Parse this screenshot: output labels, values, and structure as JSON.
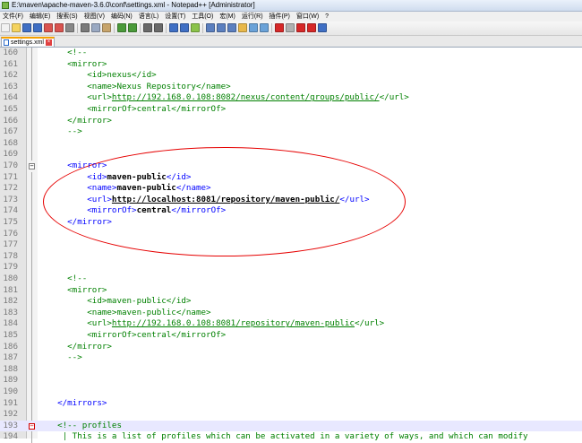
{
  "window": {
    "title": "E:\\maven\\apache-maven-3.6.0\\conf\\settings.xml - Notepad++ [Administrator]"
  },
  "menu": [
    "文件(F)",
    "编辑(E)",
    "搜索(S)",
    "视图(V)",
    "编码(N)",
    "语言(L)",
    "设置(T)",
    "工具(O)",
    "宏(M)",
    "运行(R)",
    "插件(P)",
    "窗口(W)",
    "?"
  ],
  "toolbar": {
    "icons": [
      "new-file-icon",
      "open-icon",
      "save-icon",
      "save-all-icon",
      "close-icon",
      "close-all-icon",
      "print-icon",
      "cut-icon",
      "copy-icon",
      "paste-icon",
      "undo-icon",
      "redo-icon",
      "find-icon",
      "replace-icon",
      "zoom-in-icon",
      "zoom-out-icon",
      "sync-icon",
      "wrap-icon",
      "indent-guide-icon",
      "all-chars-icon",
      "folder-icon",
      "doc-map-icon",
      "function-list-icon",
      "record-macro-icon",
      "stop-macro-icon",
      "play-macro-icon",
      "run-macro-icon",
      "save-macro-icon"
    ]
  },
  "tab": {
    "label": "settings.xml"
  },
  "lines": [
    {
      "n": "160",
      "fold": "",
      "parts": [
        {
          "c": "cm",
          "t": "    <!--"
        }
      ]
    },
    {
      "n": "161",
      "fold": "",
      "parts": [
        {
          "c": "cm",
          "t": "    <mirror>"
        }
      ]
    },
    {
      "n": "162",
      "fold": "",
      "parts": [
        {
          "c": "cm",
          "t": "        <id>nexus</id>"
        }
      ]
    },
    {
      "n": "163",
      "fold": "",
      "parts": [
        {
          "c": "cm",
          "t": "        <name>Nexus Repository</name>"
        }
      ]
    },
    {
      "n": "164",
      "fold": "",
      "parts": [
        {
          "c": "cm",
          "t": "        <url>"
        },
        {
          "c": "cm ul",
          "t": "http://192.168.0.108:8082/nexus/content/groups/public/"
        },
        {
          "c": "cm",
          "t": "</url>"
        }
      ]
    },
    {
      "n": "165",
      "fold": "",
      "parts": [
        {
          "c": "cm",
          "t": "        <mirrorOf>central</mirrorOf>"
        }
      ]
    },
    {
      "n": "166",
      "fold": "",
      "parts": [
        {
          "c": "cm",
          "t": "    </mirror>"
        }
      ]
    },
    {
      "n": "167",
      "fold": "",
      "parts": [
        {
          "c": "cm",
          "t": "    -->"
        }
      ]
    },
    {
      "n": "168",
      "fold": "",
      "parts": []
    },
    {
      "n": "169",
      "fold": "",
      "parts": []
    },
    {
      "n": "170",
      "fold": "box",
      "parts": [
        {
          "c": "tg",
          "t": "    <mirror>"
        }
      ]
    },
    {
      "n": "171",
      "fold": "",
      "parts": [
        {
          "c": "tg",
          "t": "        <id>"
        },
        {
          "c": "bd",
          "t": "maven-public"
        },
        {
          "c": "tg",
          "t": "</id>"
        }
      ]
    },
    {
      "n": "172",
      "fold": "",
      "parts": [
        {
          "c": "tg",
          "t": "        <name>"
        },
        {
          "c": "bd",
          "t": "maven-public"
        },
        {
          "c": "tg",
          "t": "</name>"
        }
      ]
    },
    {
      "n": "173",
      "fold": "",
      "parts": [
        {
          "c": "tg",
          "t": "        <url>"
        },
        {
          "c": "bd ul",
          "t": "http://localhost:8081/repository/maven-public/"
        },
        {
          "c": "tg",
          "t": "</url>"
        }
      ]
    },
    {
      "n": "174",
      "fold": "",
      "parts": [
        {
          "c": "tg",
          "t": "        <mirrorOf>"
        },
        {
          "c": "bd",
          "t": "central"
        },
        {
          "c": "tg",
          "t": "</mirrorOf>"
        }
      ]
    },
    {
      "n": "175",
      "fold": "",
      "parts": [
        {
          "c": "tg",
          "t": "    </mirror>"
        }
      ]
    },
    {
      "n": "176",
      "fold": "",
      "parts": []
    },
    {
      "n": "177",
      "fold": "",
      "parts": []
    },
    {
      "n": "178",
      "fold": "",
      "parts": []
    },
    {
      "n": "179",
      "fold": "",
      "parts": []
    },
    {
      "n": "180",
      "fold": "",
      "parts": [
        {
          "c": "cm",
          "t": "    <!--"
        }
      ]
    },
    {
      "n": "181",
      "fold": "",
      "parts": [
        {
          "c": "cm",
          "t": "    <mirror>"
        }
      ]
    },
    {
      "n": "182",
      "fold": "",
      "parts": [
        {
          "c": "cm",
          "t": "        <id>maven-public</id>"
        }
      ]
    },
    {
      "n": "183",
      "fold": "",
      "parts": [
        {
          "c": "cm",
          "t": "        <name>maven-public</name>"
        }
      ]
    },
    {
      "n": "184",
      "fold": "",
      "parts": [
        {
          "c": "cm",
          "t": "        <url>"
        },
        {
          "c": "cm ul",
          "t": "http://192.168.0.108:8081/repository/maven-public"
        },
        {
          "c": "cm",
          "t": "</url>"
        }
      ]
    },
    {
      "n": "185",
      "fold": "",
      "parts": [
        {
          "c": "cm",
          "t": "        <mirrorOf>central</mirrorOf>"
        }
      ]
    },
    {
      "n": "186",
      "fold": "",
      "parts": [
        {
          "c": "cm",
          "t": "    </mirror>"
        }
      ]
    },
    {
      "n": "187",
      "fold": "",
      "parts": [
        {
          "c": "cm",
          "t": "    -->"
        }
      ]
    },
    {
      "n": "188",
      "fold": "",
      "parts": []
    },
    {
      "n": "189",
      "fold": "",
      "parts": []
    },
    {
      "n": "190",
      "fold": "",
      "parts": []
    },
    {
      "n": "191",
      "fold": "",
      "parts": [
        {
          "c": "tg",
          "t": "  </mirrors>"
        }
      ]
    },
    {
      "n": "192",
      "fold": "",
      "parts": []
    },
    {
      "n": "193",
      "fold": "red",
      "parts": [
        {
          "c": "cm",
          "t": "  <!-- profiles"
        }
      ]
    },
    {
      "n": "194",
      "fold": "",
      "parts": [
        {
          "c": "cm",
          "t": "   | This is a list of profiles which can be activated in a variety of ways, and which can modify"
        }
      ]
    }
  ],
  "colors": {
    "comment": "#008000",
    "tag": "#0000ff",
    "highlight_ring": "#e60000",
    "tab_accent": "#f5a000"
  }
}
